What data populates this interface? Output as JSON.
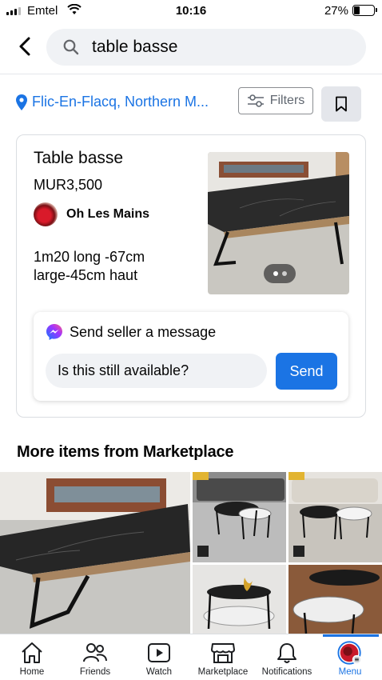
{
  "status_bar": {
    "carrier": "Emtel",
    "time": "10:16",
    "battery": "27%"
  },
  "search": {
    "query": "table basse"
  },
  "location": {
    "text": "Flic-En-Flacq, Northern M..."
  },
  "filters_label": "Filters",
  "listing": {
    "title": "Table basse",
    "price": "MUR3,500",
    "seller": "Oh Les Mains",
    "description_lines": [
      "1m20 long -67cm",
      "large-45cm haut"
    ]
  },
  "message": {
    "title": "Send seller a message",
    "input_value": "Is this still available?",
    "send_label": "Send"
  },
  "more_items_title": "More items from Marketplace",
  "tabs": [
    {
      "label": "Home",
      "icon": "home-icon"
    },
    {
      "label": "Friends",
      "icon": "friends-icon"
    },
    {
      "label": "Watch",
      "icon": "watch-icon"
    },
    {
      "label": "Marketplace",
      "icon": "marketplace-icon"
    },
    {
      "label": "Notifications",
      "icon": "bell-icon"
    },
    {
      "label": "Menu",
      "icon": "profile-avatar-icon",
      "active": true
    }
  ],
  "colors": {
    "accent": "#1b74e4",
    "search_bg": "#f0f2f5",
    "text": "#050505"
  }
}
